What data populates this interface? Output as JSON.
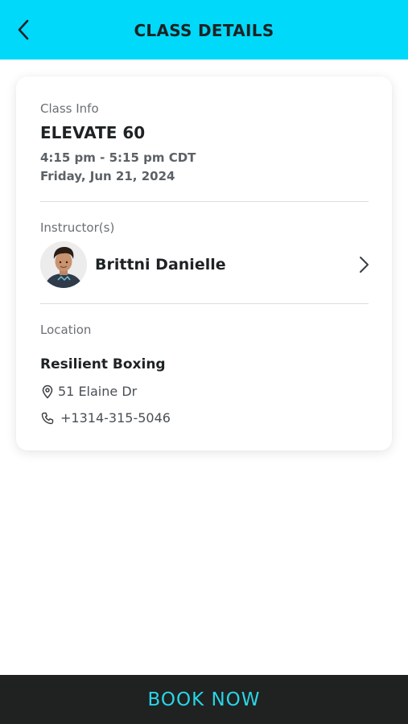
{
  "header": {
    "title": "CLASS DETAILS",
    "back_icon": "chevron-left-icon",
    "background": "#00d9f9"
  },
  "class_info": {
    "label": "Class Info",
    "name": "ELEVATE 60",
    "time": "4:15 pm - 5:15 pm CDT",
    "date": "Friday, Jun 21, 2024"
  },
  "instructors": {
    "label": "Instructor(s)",
    "items": [
      {
        "name": "Brittni Danielle",
        "avatar_icon": "avatar-photo",
        "chevron_icon": "chevron-right-icon"
      }
    ]
  },
  "location": {
    "label": "Location",
    "name": "Resilient Boxing",
    "address": "51 Elaine Dr",
    "address_icon": "map-pin-icon",
    "phone": "+1314-315-5046",
    "phone_icon": "phone-icon"
  },
  "footer": {
    "book_label": "BOOK NOW",
    "background": "#1f2220",
    "text_color": "#2ad4e8"
  }
}
